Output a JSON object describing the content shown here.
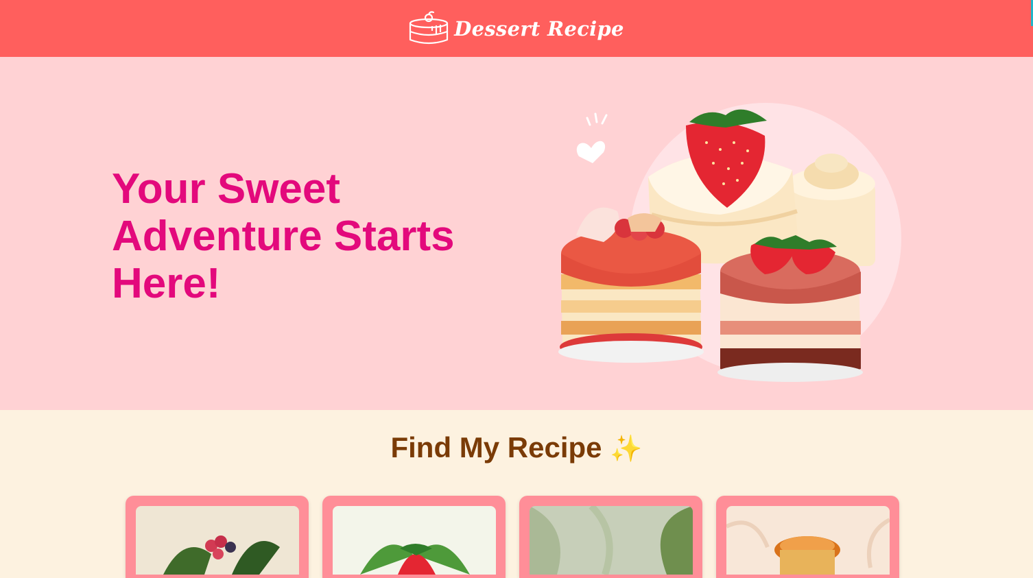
{
  "header": {
    "brand_name": "Dessert Recipe",
    "logo_icon": "cake-icon",
    "background_color": "#ff5f5d"
  },
  "hero": {
    "title": "Your Sweet Adventure Starts Here!",
    "title_color": "#e3097c",
    "background_color": "#ffd2d4",
    "illustration": "strawberry-cakes-illustration"
  },
  "find_section": {
    "title": "Find My Recipe",
    "title_emoji": "✨",
    "title_color": "#7a3b06",
    "background_color": "#fdf2e0",
    "cards": [
      {
        "image": "berries-leaves-image"
      },
      {
        "image": "strawberry-leaves-image"
      },
      {
        "image": "green-leaves-image"
      },
      {
        "image": "caramel-dessert-image"
      }
    ],
    "card_color": "#ff8e98"
  }
}
